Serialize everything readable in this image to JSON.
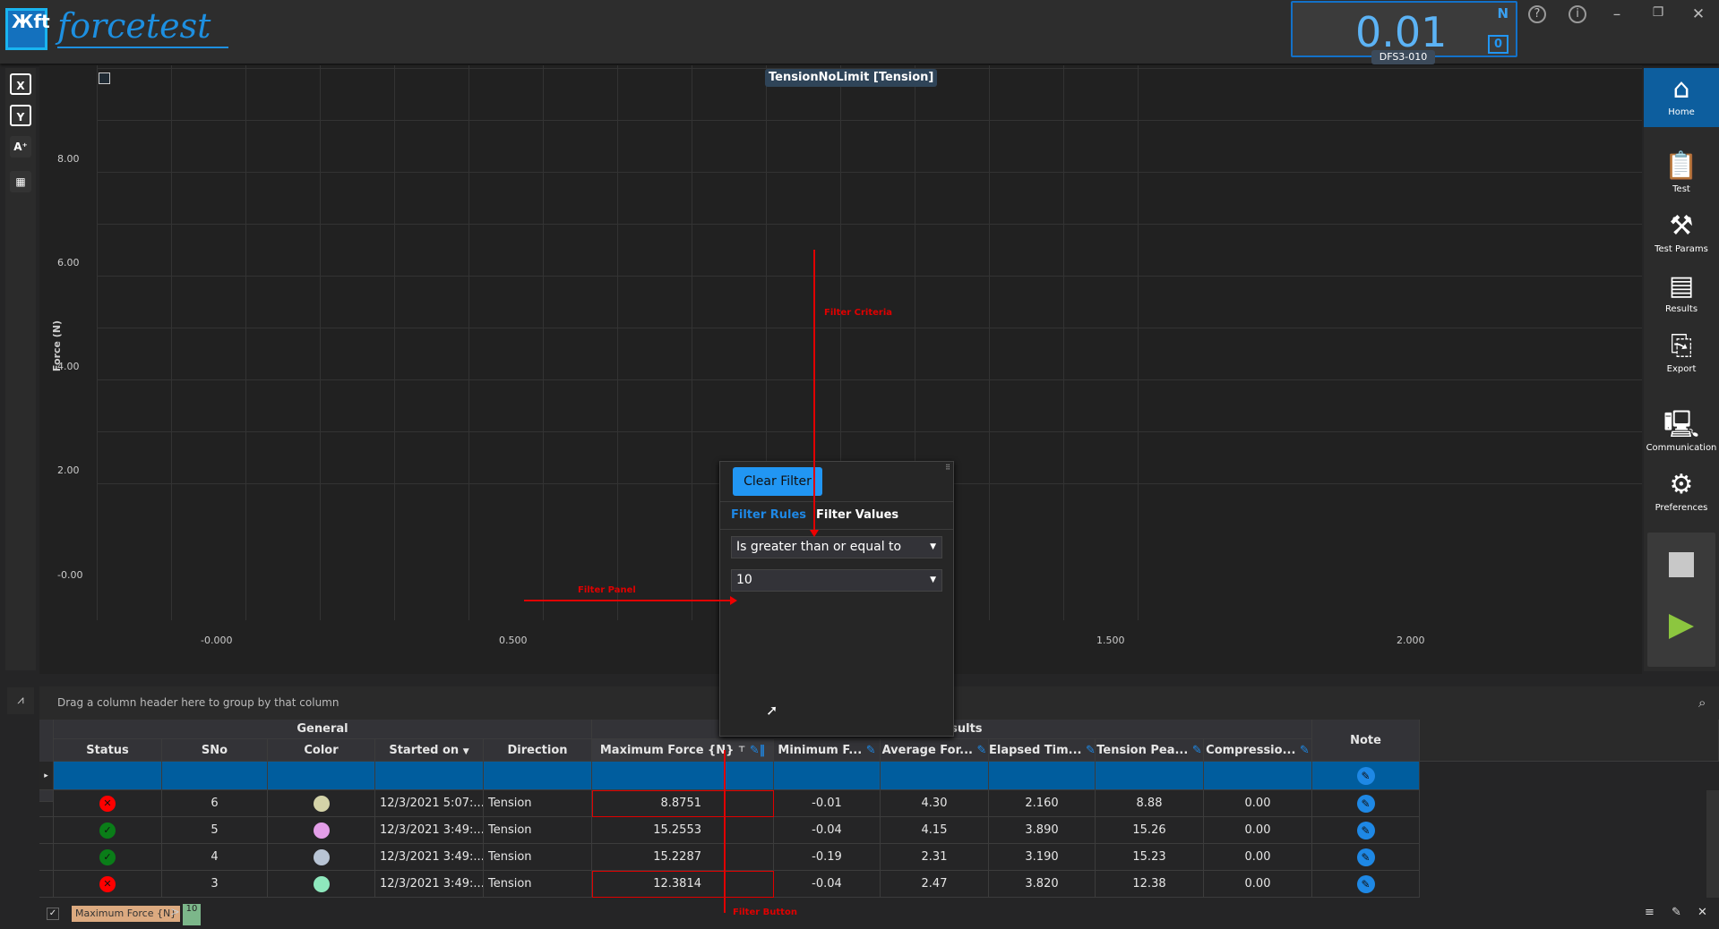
{
  "app": {
    "logo_mark": "Жft",
    "logo_text": "forcetest"
  },
  "readout": {
    "value": "0.01",
    "unit": "N",
    "zero_label": "0",
    "device": "DFS3-010"
  },
  "window": {
    "help_icon": "?",
    "info_icon": "i",
    "minimize": "–",
    "restore": "❐",
    "close": "✕"
  },
  "left_tools": [
    {
      "label": "X",
      "icon": "x-axis-icon"
    },
    {
      "label": "Y",
      "icon": "y-axis-icon"
    },
    {
      "label": "A⁺",
      "icon": "font-size-icon"
    },
    {
      "label": "▦",
      "icon": "table-icon"
    }
  ],
  "chart_data": {
    "type": "line",
    "title": "TensionNoLimit [Tension]",
    "ylabel": "Force (N)",
    "xlabel": "",
    "y_ticks": [
      "8.00",
      "6.00",
      "4.00",
      "2.00",
      "-0.00"
    ],
    "x_ticks": [
      "-0.000",
      "0.500",
      "1.000",
      "1.500",
      "2.000"
    ],
    "grid": true,
    "series": []
  },
  "right_nav": [
    {
      "label": "Home",
      "icon": "home-icon",
      "active": true
    },
    {
      "label": "Test",
      "icon": "test-icon"
    },
    {
      "label": "Test Params",
      "icon": "test-params-icon"
    },
    {
      "label": "Results",
      "icon": "results-icon"
    },
    {
      "label": "Export",
      "icon": "export-icon"
    },
    {
      "label": "Communication",
      "icon": "communication-icon"
    },
    {
      "label": "Preferences",
      "icon": "preferences-icon"
    }
  ],
  "controls": {
    "stop": "stop-icon",
    "play": "play-icon",
    "play_color": "#8cc63f"
  },
  "filter": {
    "clear_label": "Clear Filter",
    "tab_rules": "Filter Rules",
    "tab_values": "Filter Values",
    "operator": "Is greater than or equal to",
    "value": "10"
  },
  "annotations": {
    "criteria": "Filter Criteria",
    "panel": "Filter Panel",
    "button": "Filter Button"
  },
  "grid": {
    "group_hint": "Drag a column header here to group by that column",
    "group_general": "General",
    "group_results": "d Results",
    "columns": [
      "Status",
      "SNo",
      "Color",
      "Started on",
      "Direction",
      "Maximum Force {N}",
      "Minimum F...",
      "Average For...",
      "Elapsed Tim...",
      "Tension Pea...",
      "Compressio...",
      "Note"
    ],
    "rows": [
      {
        "status": "fail",
        "sno": "6",
        "color": "#d4d3a8",
        "started": "12/3/2021 5:07:...",
        "direction": "Tension",
        "max": "8.8751",
        "min": "-0.01",
        "avg": "4.30",
        "elapsed": "2.160",
        "tension": "8.88",
        "comp": "0.00"
      },
      {
        "status": "pass",
        "sno": "5",
        "color": "#e39ee8",
        "started": "12/3/2021 3:49:...",
        "direction": "Tension",
        "max": "15.2553",
        "min": "-0.04",
        "avg": "4.15",
        "elapsed": "3.890",
        "tension": "15.26",
        "comp": "0.00"
      },
      {
        "status": "pass",
        "sno": "4",
        "color": "#b8c4d4",
        "started": "12/3/2021 3:49:...",
        "direction": "Tension",
        "max": "15.2287",
        "min": "-0.19",
        "avg": "2.31",
        "elapsed": "3.190",
        "tension": "15.23",
        "comp": "0.00"
      },
      {
        "status": "fail",
        "sno": "3",
        "color": "#8ee8bd",
        "started": "12/3/2021 3:49:...",
        "direction": "Tension",
        "max": "12.3814",
        "min": "-0.04",
        "avg": "2.47",
        "elapsed": "3.820",
        "tension": "12.38",
        "comp": "0.00"
      }
    ],
    "footer_filter_field": "Maximum Force {N}",
    "footer_filter_op": ">",
    "footer_filter_value": "10"
  }
}
